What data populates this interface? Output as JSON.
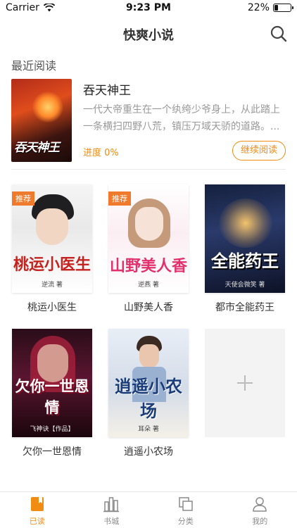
{
  "status_bar": {
    "carrier": "Carrier",
    "time": "9:23 PM",
    "battery": "22%",
    "battery_level": 0.22
  },
  "nav": {
    "title": "快爽小说"
  },
  "recent": {
    "section_label": "最近阅读",
    "book": {
      "title": "吞天神王",
      "cover_text": "吞天神王",
      "description": "一代大帝重生在一个纨绔少爷身上，从此踏上一条横扫四野八荒，镇压万域天骄的道路。...",
      "progress": "进度 0%",
      "continue_label": "继续阅读"
    }
  },
  "shelf": {
    "tag_label": "推荐",
    "books": [
      {
        "name": "桃运小医生",
        "cover_text": "桃运小医生",
        "author": "逆流 著"
      },
      {
        "name": "山野美人香",
        "cover_text": "山野美人香",
        "author": "逆燕 著"
      },
      {
        "name": "都市全能药王",
        "cover_text": "全能药王",
        "author": "天使会微笑 著"
      },
      {
        "name": "欠你一世恩情",
        "cover_text": "欠你一世恩情",
        "author": "飞神诀【作品】"
      },
      {
        "name": "逍遥小农场",
        "cover_text": "逍遥小农场",
        "author": "耳朵 著"
      }
    ]
  },
  "tabs": [
    {
      "label": "已读",
      "icon": "book-icon",
      "active": true
    },
    {
      "label": "书城",
      "icon": "books-icon",
      "active": false
    },
    {
      "label": "分类",
      "icon": "category-icon",
      "active": false
    },
    {
      "label": "我的",
      "icon": "user-icon",
      "active": false
    }
  ],
  "colors": {
    "accent": "#f08b14",
    "tag": "#ef7a2c"
  }
}
